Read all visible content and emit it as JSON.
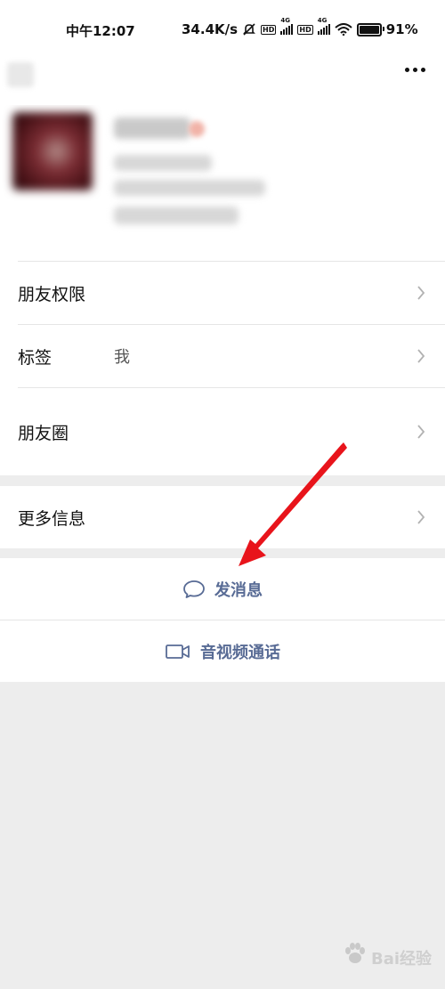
{
  "status_bar": {
    "time": "中午12:07",
    "network_speed": "34.4K/s",
    "hd_label": "HD",
    "network_type": "4G",
    "battery_level": 0.91,
    "battery_text": "91%"
  },
  "menu": {
    "items": [
      {
        "label": "朋友权限",
        "value": ""
      },
      {
        "label": "标签",
        "value": "我"
      },
      {
        "label": "朋友圈",
        "value": ""
      }
    ],
    "more_info": {
      "label": "更多信息"
    }
  },
  "actions": {
    "send_message": "发消息",
    "video_call": "音视频通话"
  },
  "colors": {
    "accent": "#586b95",
    "arrow": "#e8141b",
    "background": "#ededed"
  },
  "watermark": {
    "text": "Bai经验"
  }
}
